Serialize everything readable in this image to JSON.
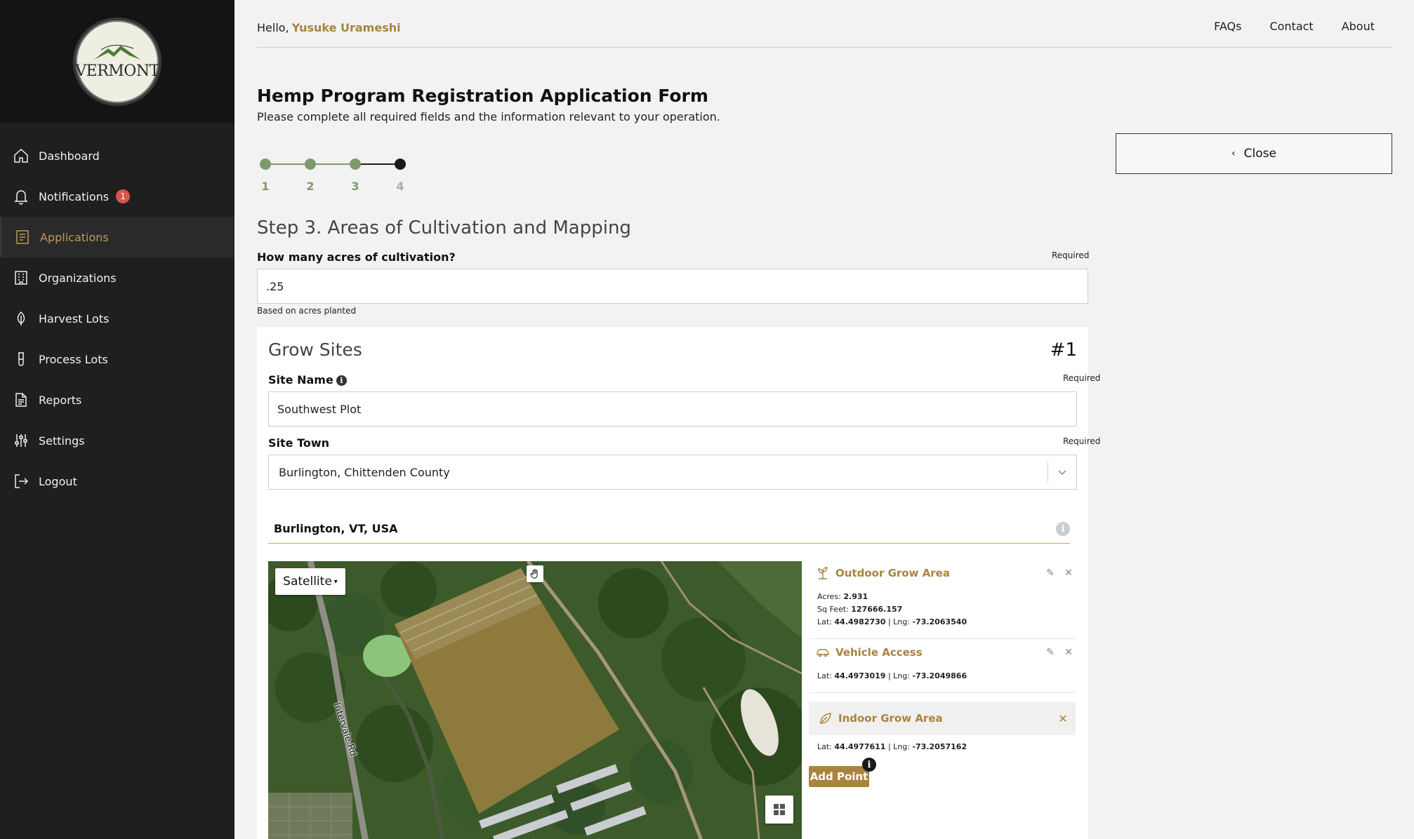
{
  "logo": {
    "text": "VERMONT"
  },
  "sidebar": {
    "items": [
      {
        "label": "Dashboard",
        "icon": "home-icon"
      },
      {
        "label": "Notifications",
        "icon": "bell-icon",
        "badge": "1"
      },
      {
        "label": "Applications",
        "icon": "document-list-icon",
        "active": true
      },
      {
        "label": "Organizations",
        "icon": "building-icon"
      },
      {
        "label": "Harvest Lots",
        "icon": "leaf-icon"
      },
      {
        "label": "Process Lots",
        "icon": "test-tube-icon"
      },
      {
        "label": "Reports",
        "icon": "report-icon"
      },
      {
        "label": "Settings",
        "icon": "sliders-icon"
      },
      {
        "label": "Logout",
        "icon": "logout-icon"
      }
    ]
  },
  "header": {
    "greeting": "Hello,",
    "user": "Yusuke Urameshi",
    "links": [
      "FAQs",
      "Contact",
      "About"
    ]
  },
  "form": {
    "title": "Hemp Program Registration Application Form",
    "subtitle": "Please complete all required fields and the information relevant to your operation.",
    "close_label": "Close",
    "steps": [
      "1",
      "2",
      "3",
      "4"
    ],
    "step_heading": "Step 3. Areas of Cultivation and Mapping",
    "acres": {
      "label": "How many acres of cultivation?",
      "required": "Required",
      "value": ".25",
      "hint": "Based on acres planted"
    }
  },
  "grow_sites": {
    "title": "Grow Sites",
    "number": "#1",
    "site_name": {
      "label": "Site Name",
      "required": "Required",
      "value": "Southwest Plot"
    },
    "site_town": {
      "label": "Site Town",
      "required": "Required",
      "value": "Burlington, Chittenden County"
    },
    "location": "Burlington, VT, USA",
    "map": {
      "type_label": "Satellite",
      "road_label": "Intervale Rd"
    },
    "features": [
      {
        "title": "Outdoor Grow Area",
        "icon": "plant-icon",
        "acres_label": "Acres:",
        "acres": "2.931",
        "sqft_label": "Sq Feet:",
        "sqft": "127666.157",
        "lat_label": "Lat:",
        "lat": "44.4982730",
        "lng_label": "Lng:",
        "lng": "-73.2063540"
      },
      {
        "title": "Vehicle Access",
        "icon": "car-icon",
        "lat_label": "Lat:",
        "lat": "44.4973019",
        "lng_label": "Lng:",
        "lng": "-73.2049866"
      },
      {
        "title": "Indoor Grow Area",
        "icon": "leaf-icon",
        "lat_label": "Lat:",
        "lat": "44.4977611",
        "lng_label": "Lng:",
        "lng": "-73.2057162"
      }
    ],
    "add_point_label": "Add Point"
  },
  "colors": {
    "accent": "#a8843f",
    "sidebar": "#1f1f1f",
    "step_done": "#7f9a6a",
    "badge": "#d9534f"
  }
}
